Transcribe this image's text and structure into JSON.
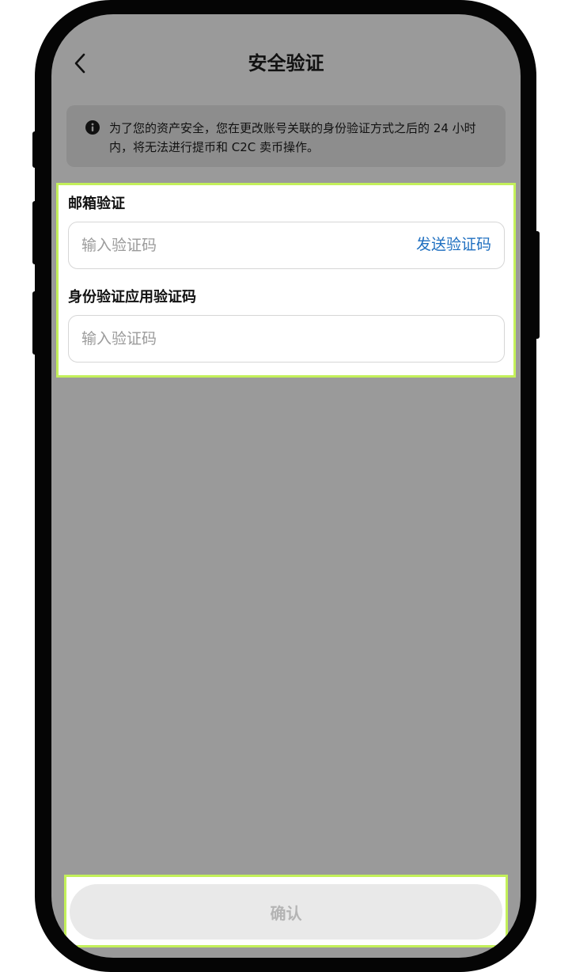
{
  "header": {
    "title": "安全验证",
    "back_icon": "chevron-left-icon"
  },
  "notice": {
    "icon": "info-icon",
    "text": "为了您的资产安全，您在更改账号关联的身份验证方式之后的 24 小时内，将无法进行提币和 C2C 卖币操作。"
  },
  "form": {
    "email_label": "邮箱验证",
    "email_placeholder": "输入验证码",
    "send_code_label": "发送验证码",
    "auth_label": "身份验证应用验证码",
    "auth_placeholder": "输入验证码"
  },
  "footer": {
    "confirm_label": "确认"
  },
  "colors": {
    "screen_overlay": "#9a9a9a",
    "highlight": "#c3f05a",
    "link": "#1f6fc0",
    "disabled_button": "#e9e9e9"
  }
}
